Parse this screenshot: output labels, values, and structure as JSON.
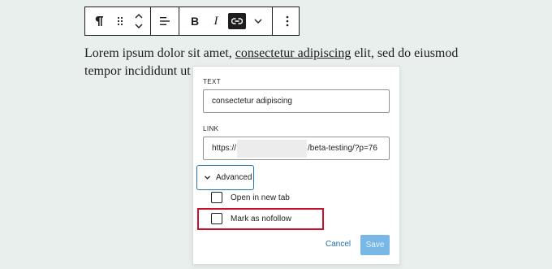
{
  "toolbar": {
    "paragraph_icon": "paragraph-icon",
    "drag_icon": "drag-handle-icon",
    "move_icon": "move-up-down-icon",
    "align_icon": "align-left-icon",
    "bold_label": "B",
    "italic_label": "I",
    "link_icon": "link-icon",
    "more_icon": "chevron-down-icon",
    "options_icon": "vertical-ellipsis-icon"
  },
  "paragraph": {
    "before": "Lorem ipsum dolor sit amet, ",
    "link_text": "consectetur adipiscing",
    "after": " elit, sed do eiusmod",
    "line2": "tempor incididunt ut"
  },
  "link_popover": {
    "text_label": "TEXT",
    "text_value": "consectetur adipiscing",
    "link_label": "LINK",
    "link_prefix": "https://",
    "link_suffix": "/beta-testing/?p=76",
    "advanced_label": "Advanced",
    "open_new_tab_label": "Open in new tab",
    "nofollow_label": "Mark as nofollow",
    "cancel_label": "Cancel",
    "save_label": "Save"
  },
  "colors": {
    "background": "#e8efec",
    "accent": "#2271b1",
    "highlight": "#c9112e",
    "save_disabled": "#79b8e6"
  }
}
